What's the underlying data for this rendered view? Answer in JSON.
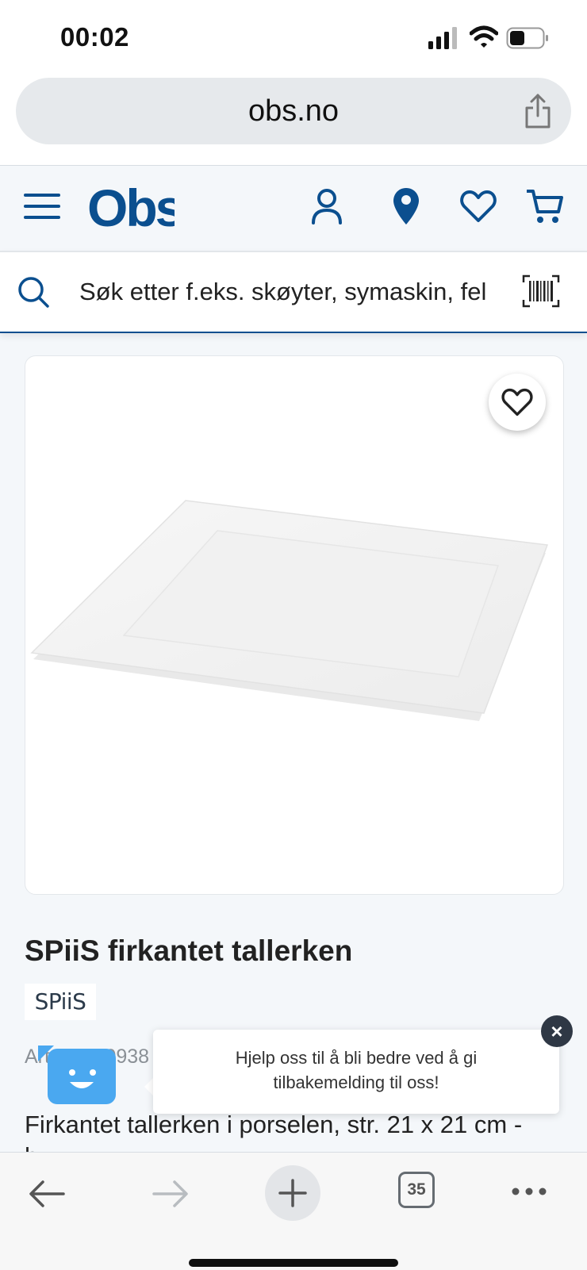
{
  "status_bar": {
    "time": "00:02",
    "battery_level": 0.45
  },
  "browser": {
    "url": "obs.no",
    "open_tabs": "35"
  },
  "site": {
    "logo_text": "Obs",
    "brand_color": "#0b4f8f",
    "search": {
      "placeholder": "Søk etter f.eks. skøyter, symaskin, fel"
    }
  },
  "product": {
    "title": "SPiiS firkantet tallerken",
    "brand": "SPiiS",
    "article_number": "Art.nr. 570938",
    "article_right": "",
    "description_line1": "Firkantet tallerken i porselen, str. 21 x 21 cm -",
    "description_line2": "h"
  },
  "feedback": {
    "message_line1": "Hjelp oss til å bli bedre ved å gi",
    "message_line2": "tilbakemelding til oss!",
    "close_label": "×"
  },
  "icons": {
    "header": [
      "hamburger-icon",
      "account-icon",
      "location-icon",
      "heart-icon",
      "cart-icon"
    ],
    "search": [
      "search-icon",
      "barcode-icon"
    ],
    "bottom": [
      "back-icon",
      "forward-icon",
      "plus-icon",
      "tabs-icon",
      "more-icon"
    ]
  }
}
